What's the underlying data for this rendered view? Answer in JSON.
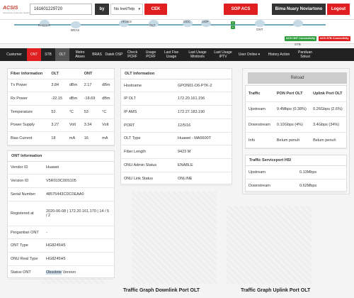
{
  "header": {
    "logo": "ACSIS",
    "logo_sub": "Assurance Customer System",
    "search_value": "161601229720",
    "by_label": "by",
    "select_value": "No Inet/Telp",
    "cek_label": "CEK",
    "sop_label": "SOP ACS",
    "user_name": "Bima Nuary Noviartono",
    "logout_label": "Logout"
  },
  "topology": {
    "nodes": [
      "RADIUS",
      "BRAS",
      "AKSES",
      "OLT",
      "ODC",
      "ODP",
      "ONT",
      "STB"
    ],
    "ont_connectivity": "ACS ONT Connectivity",
    "stb_connectivity": "ACS STB Connectivity"
  },
  "nav": {
    "items": [
      "Customer",
      "ONT",
      "STB",
      "OLT",
      "Metro Akses",
      "BRAS",
      "Datek OSP",
      "Check PCRF",
      "Usage PCRF",
      "Last Five Usage",
      "Last Usage Minitools",
      "Last Usage IPTV",
      "User Online ▾",
      "History Action",
      "Panduan Solusi"
    ]
  },
  "fiber": {
    "title": "Fiber Information",
    "col_olt": "OLT",
    "col_ont": "ONT",
    "rows": [
      {
        "label": "Tx Power",
        "olt": "3.84",
        "olt_unit": "dBm",
        "ont": "2.17",
        "ont_unit": "dBm"
      },
      {
        "label": "Rx Power",
        "olt": "-22.15",
        "olt_unit": "dBm",
        "ont": "-18.69",
        "ont_unit": "dBm"
      },
      {
        "label": "Temperature",
        "olt": "52",
        "olt_unit": "°C",
        "ont": "53",
        "ont_unit": "°C"
      },
      {
        "label": "Power Supply",
        "olt": "3.27",
        "olt_unit": "Volt",
        "ont": "3.34",
        "ont_unit": "Volt"
      },
      {
        "label": "Bias Current",
        "olt": "18",
        "olt_unit": "mA",
        "ont": "16",
        "ont_unit": "mA"
      }
    ]
  },
  "ont": {
    "title": "ONT Information",
    "rows": [
      {
        "label": "Vendor ID",
        "value": "Huawei"
      },
      {
        "label": "Version ID",
        "value": "V5R019C00S105"
      },
      {
        "label": "Serial Number",
        "value": "48575443CDC0EAA0"
      },
      {
        "label": "Registered at",
        "value": "2020-06-08 | 172.20.161.170 | 14 / 5 / 2"
      },
      {
        "label": "Pergantian ONT",
        "value": "-"
      },
      {
        "label": "ONT Type",
        "value": "HG8245H5"
      },
      {
        "label": "ONU Real Type",
        "value": "HG8245H5"
      },
      {
        "label": "Status ONT",
        "value_a": "Obsolete",
        "value_b": " Version"
      }
    ]
  },
  "olt": {
    "title": "OLT Information",
    "rows": [
      {
        "label": "Hostname",
        "value": "GPON01-D6-PTK-2"
      },
      {
        "label": "IP OLT",
        "value": "172.20.161.156"
      },
      {
        "label": "IP AMS",
        "value": "172.27.183.190"
      },
      {
        "label": "PORT",
        "value": "12/5/16"
      },
      {
        "label": "OLT Type",
        "value": "Huawei - MA5600T"
      },
      {
        "label": "Fiber Length",
        "value": "9423 M"
      },
      {
        "label": "ONU Admin Status",
        "value": "ENABLE"
      },
      {
        "label": "ONU Link Status",
        "value": "ONLINE"
      }
    ]
  },
  "traffic": {
    "reload_label": "Reload",
    "col_downlink": "PON Port OLT",
    "col_uplink": "Uplink Port OLT",
    "header_label": "Traffic",
    "rows": [
      {
        "label": "Upstream",
        "down": "9.4Mbps (0.38%)",
        "up": "0.26Gbps (2.6%)"
      },
      {
        "label": "Downstream",
        "down": "0.10Gbps (4%)",
        "up": "3.4Gbps (34%)"
      },
      {
        "label": "Info",
        "down": "Belum penuh",
        "up": "Belum penuh"
      }
    ]
  },
  "service": {
    "title": "Traffic Serviceport HSI",
    "rows": [
      {
        "label": "Upstream",
        "value": "0.13Mbps"
      },
      {
        "label": "Downstream",
        "value": "0.62Mbps"
      }
    ]
  },
  "graphs": {
    "downlink_title": "Traffic Graph Downlink Port OLT",
    "uplink_title": "Traffic Graph Uplink Port OLT"
  },
  "colors": {
    "accent": "#e02020",
    "dark": "#222222",
    "green": "#2e9e3e"
  }
}
